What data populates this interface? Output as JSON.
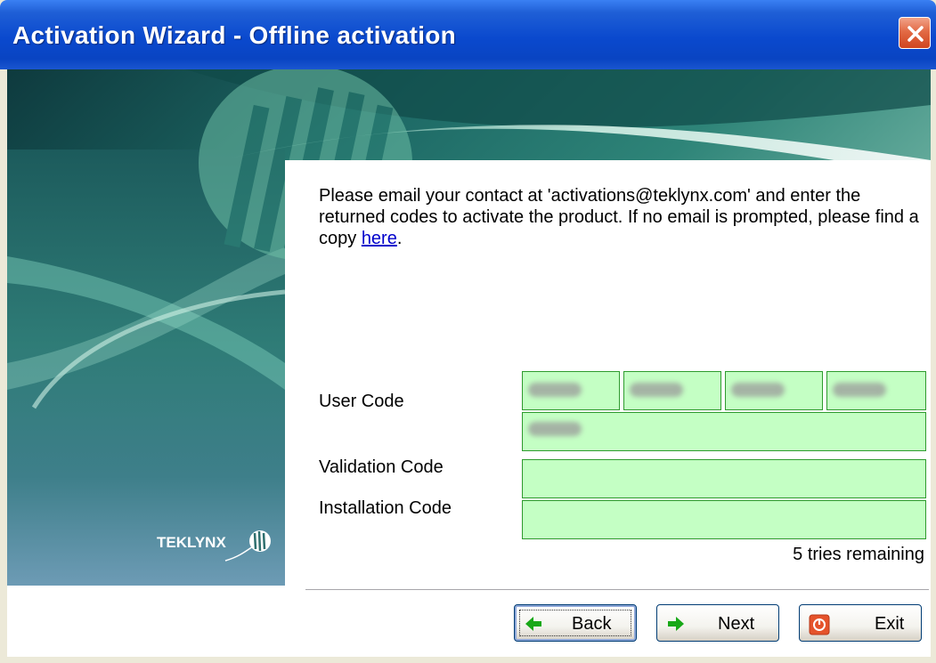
{
  "window": {
    "title": "Activation Wizard - Offline activation",
    "close_icon": "close-icon"
  },
  "instructions": {
    "text_before_link": "Please email your contact at 'activations@teklynx.com' and enter the returned codes to activate the product. If no email is prompted, please find a copy ",
    "link_text": "here",
    "text_after_link": "."
  },
  "form": {
    "user_code_label": "User Code",
    "validation_code_label": "Validation Code",
    "installation_code_label": "Installation Code",
    "validation_code_value": "",
    "installation_code_value": ""
  },
  "status": {
    "tries_remaining": "5 tries remaining"
  },
  "buttons": {
    "back_label": "Back",
    "next_label": "Next",
    "exit_label": "Exit"
  },
  "brand": {
    "logo_text": "TEKLYNX"
  },
  "colors": {
    "titlebar": "#0A49CE",
    "code_field_fill": "#C4FFC4",
    "code_field_border": "#2E9B2E",
    "link": "#0000CC",
    "back_arrow": "#18A818",
    "exit_icon": "#E5532B"
  }
}
